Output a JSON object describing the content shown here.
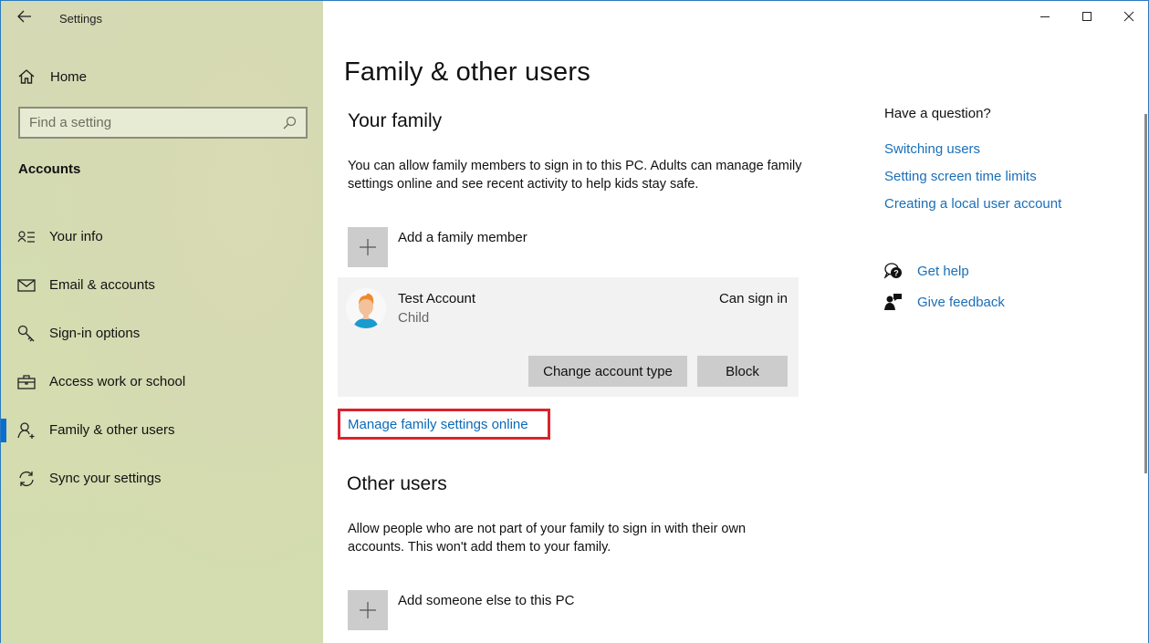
{
  "window": {
    "app_title": "Settings",
    "controls": {
      "minimize": "minimize-icon",
      "maximize": "maximize-icon",
      "close": "close-icon"
    }
  },
  "sidebar": {
    "home_label": "Home",
    "search": {
      "placeholder": "Find a setting",
      "value": ""
    },
    "section_label": "Accounts",
    "items": [
      {
        "label": "Your info",
        "icon": "contact-info-icon",
        "active": false
      },
      {
        "label": "Email & accounts",
        "icon": "mail-icon",
        "active": false
      },
      {
        "label": "Sign-in options",
        "icon": "key-icon",
        "active": false
      },
      {
        "label": "Access work or school",
        "icon": "briefcase-icon",
        "active": false
      },
      {
        "label": "Family & other users",
        "icon": "add-person-icon",
        "active": true
      },
      {
        "label": "Sync your settings",
        "icon": "sync-icon",
        "active": false
      }
    ],
    "accent_color": "#0a6ed1"
  },
  "main": {
    "page_title": "Family & other users",
    "your_family": {
      "heading": "Your family",
      "description": "You can allow family members to sign in to this PC. Adults can manage family settings online and see recent activity to help kids stay safe.",
      "add_label": "Add a family member",
      "account": {
        "name": "Test Account",
        "type": "Child",
        "status": "Can sign in",
        "change_button": "Change account type",
        "block_button": "Block"
      },
      "manage_link": "Manage family settings online",
      "highlight_color": "#d9242e"
    },
    "other_users": {
      "heading": "Other users",
      "description": "Allow people who are not part of your family to sign in with their own accounts. This won't add them to your family.",
      "add_label": "Add someone else to this PC"
    }
  },
  "aside": {
    "question": "Have a question?",
    "links": [
      "Switching users",
      "Setting screen time limits",
      "Creating a local user account"
    ],
    "get_help": "Get help",
    "give_feedback": "Give feedback",
    "link_color": "#1a6fb8"
  }
}
